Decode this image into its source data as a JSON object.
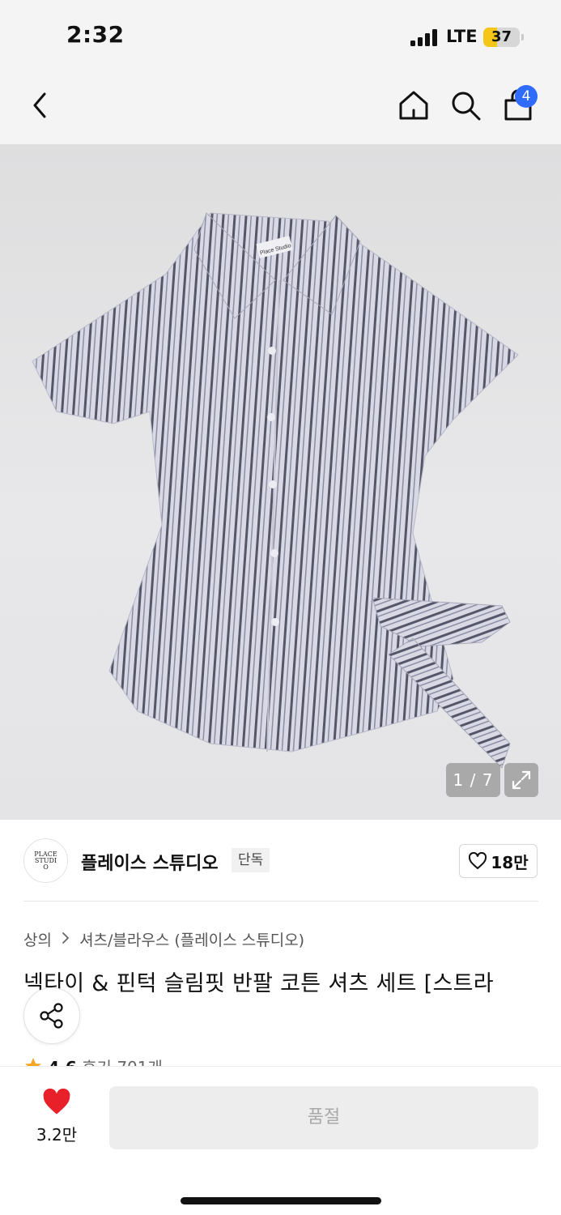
{
  "status": {
    "time": "2:32",
    "network": "LTE",
    "battery": "37",
    "battery_level": 0.37
  },
  "nav": {
    "cart_count": "4"
  },
  "gallery": {
    "counter": "1 / 7",
    "label_text": "Place Studio"
  },
  "brand": {
    "logo_text": "PLACE STUDIO",
    "name": "플레이스 스튜디오",
    "tag": "단독",
    "likes": "18만"
  },
  "breadcrumb": {
    "category": "상의",
    "subcategory": "셔츠/블라우스 (플레이스 스튜디오)"
  },
  "product": {
    "title": "넥타이 & 핀턱 슬림핏 반팔 코튼 셔츠 세트 [스트라",
    "rating": "4.6",
    "reviews": "후기 701개"
  },
  "bottom": {
    "wish_count": "3.2만",
    "buy_label": "품절"
  },
  "colors": {
    "accent": "#2f6bff",
    "heart": "#e8202a",
    "star": "#f5a623",
    "battery": "#f5c518"
  }
}
